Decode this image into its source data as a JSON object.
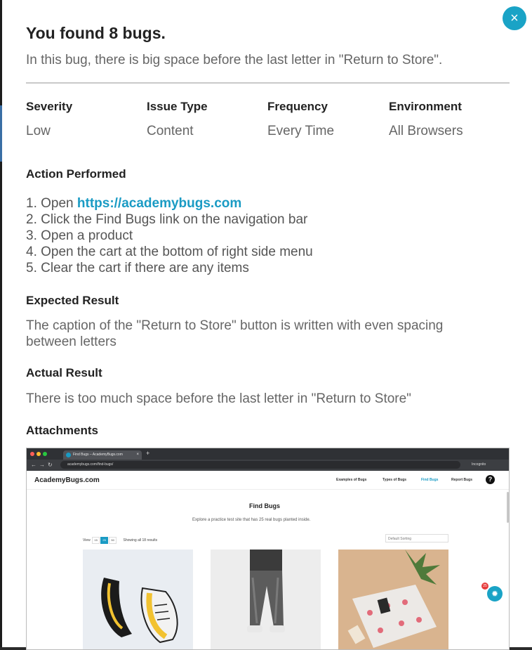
{
  "dialog": {
    "title": "You found 8 bugs.",
    "description": "In this bug, there is big space before the last letter in \"Return to Store\".",
    "close_glyph": "×"
  },
  "details": {
    "columns": [
      {
        "label": "Severity",
        "value": "Low"
      },
      {
        "label": "Issue Type",
        "value": "Content"
      },
      {
        "label": "Frequency",
        "value": "Every Time"
      },
      {
        "label": "Environment",
        "value": "All Browsers"
      }
    ]
  },
  "action": {
    "heading": "Action Performed",
    "steps": [
      {
        "prefix": "1. Open ",
        "link": "https://academybugs.com"
      },
      {
        "text": "2. Click the Find Bugs link on the navigation bar"
      },
      {
        "text": "3. Open a product"
      },
      {
        "text": "4. Open the cart at the bottom of right side menu"
      },
      {
        "text": "5. Clear the cart if there are any items"
      }
    ]
  },
  "expected": {
    "heading": "Expected Result",
    "text": "The caption of the \"Return to Store\" button is written with even spacing between letters"
  },
  "actual": {
    "heading": "Actual Result",
    "text": "There is too much space before the last letter in \"Return to Store\""
  },
  "attachments": {
    "heading": "Attachments",
    "screenshot": {
      "tab_title": "Find Bugs – AcademyBugs.com",
      "url": "academybugs.com/find-bugs/",
      "incognito": "Incognito",
      "site_logo": "AcademyBugs.com",
      "nav": [
        "Examples of Bugs",
        "Types of Bugs",
        "Find Bugs",
        "Report Bugs"
      ],
      "help_glyph": "?",
      "page_title": "Find Bugs",
      "page_subtitle": "Explore a practice test site that has 25 real bugs planted inside.",
      "view_label": "View",
      "view_options": [
        "15",
        "25",
        "50"
      ],
      "results_text": "Showing all 18 results",
      "sorting": "Default Sorting",
      "bug_counter": "25",
      "colors": {
        "accent": "#1aa3c6",
        "badge": "#e63b3b"
      }
    }
  }
}
